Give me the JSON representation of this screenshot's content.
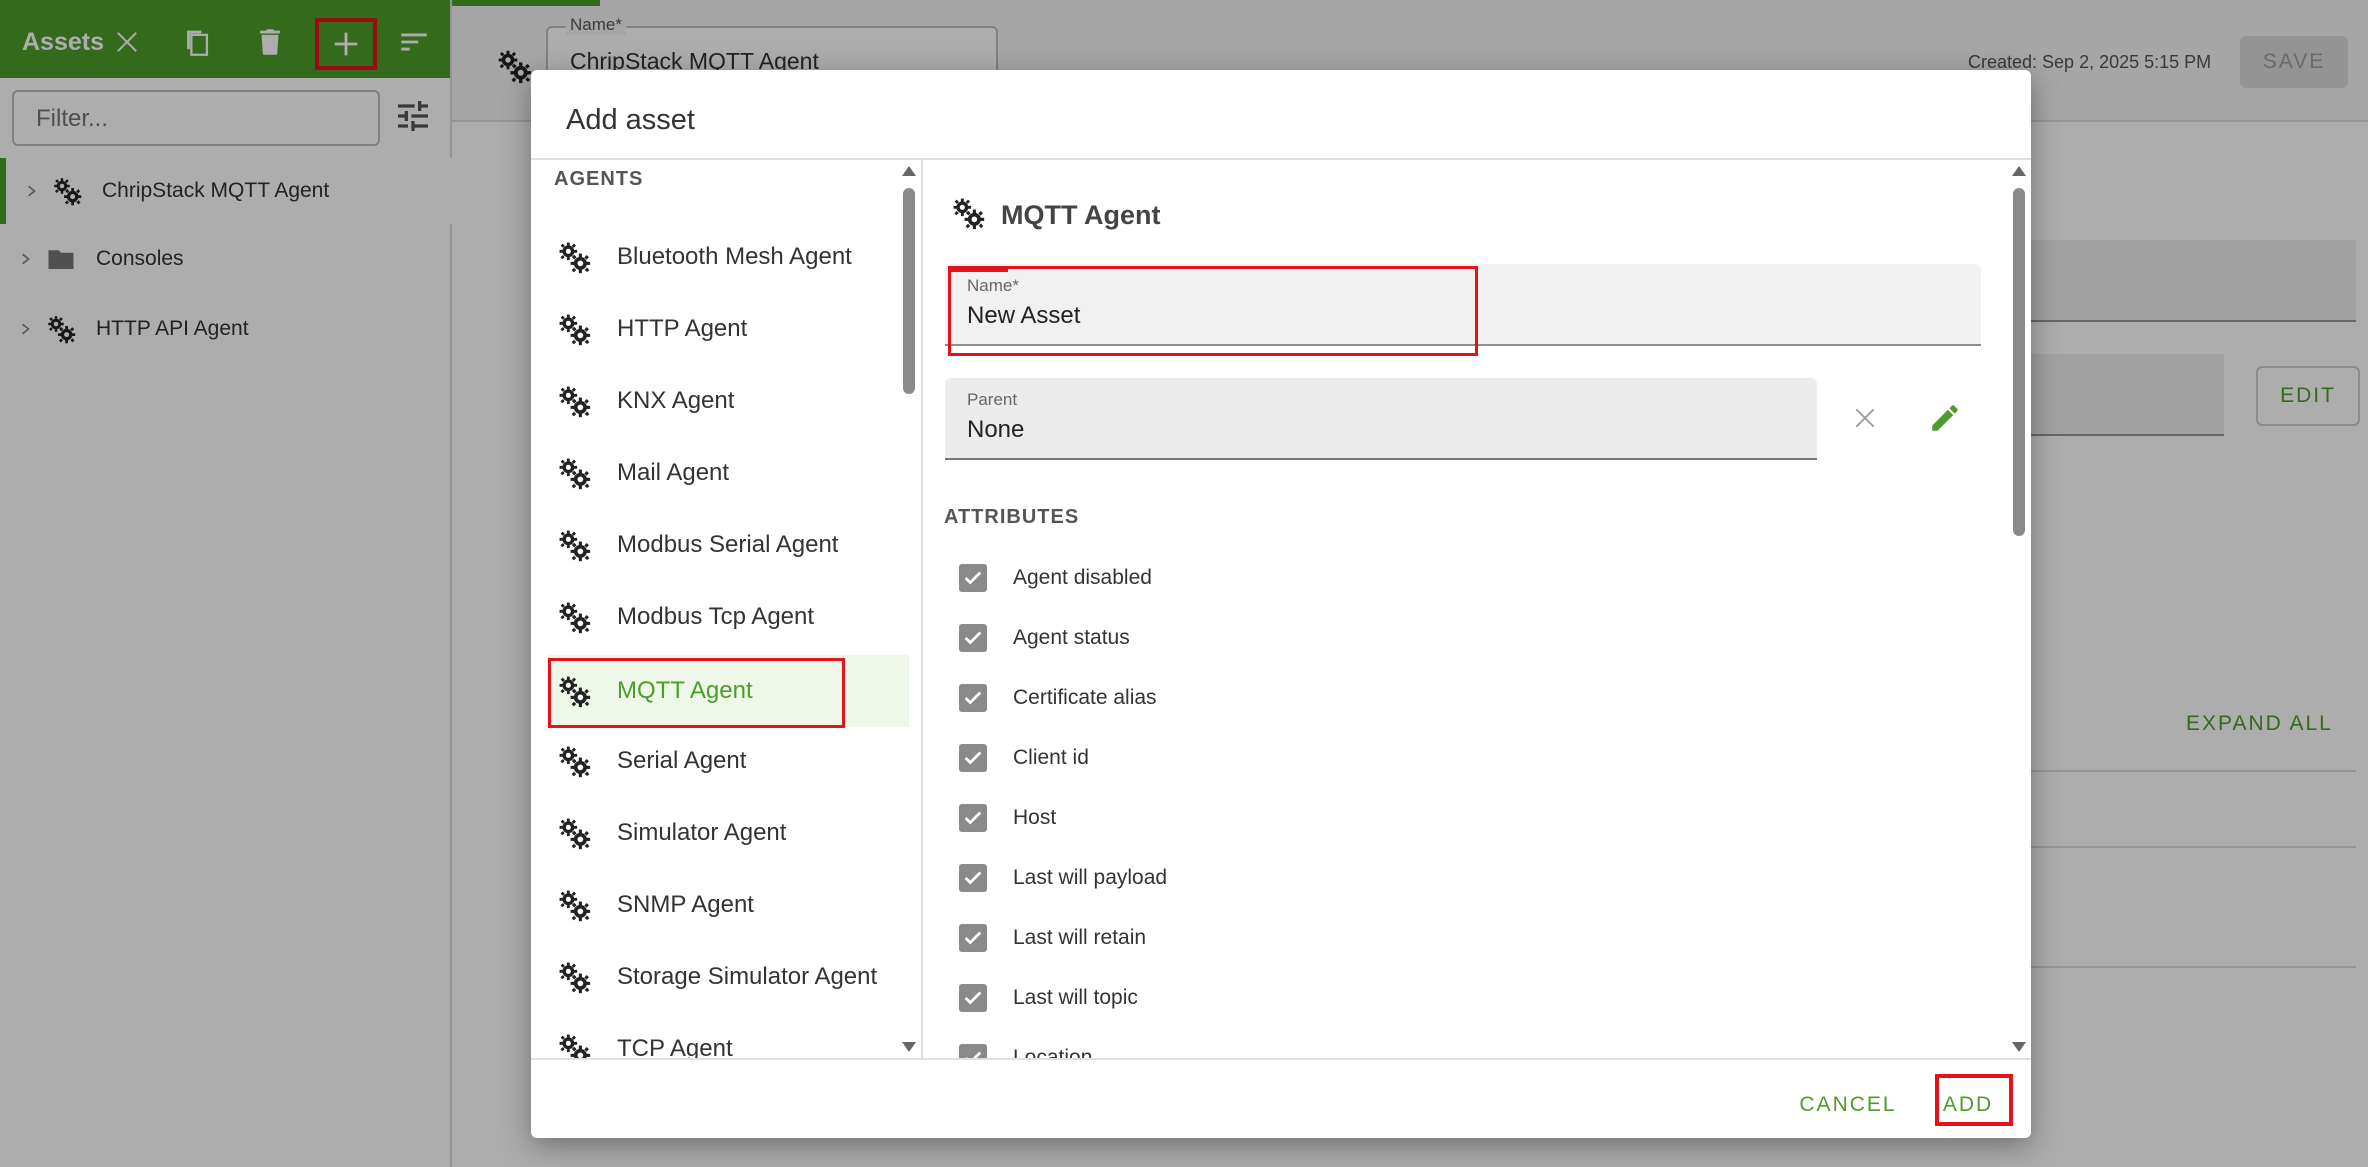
{
  "sidebar": {
    "title": "Assets",
    "filter_placeholder": "Filter...",
    "tree": [
      {
        "label": "ChripStack MQTT Agent",
        "icon": "gears-icon"
      },
      {
        "label": "Consoles",
        "icon": "folder-icon"
      },
      {
        "label": "HTTP API Agent",
        "icon": "gears-icon"
      }
    ]
  },
  "topbar": {
    "name_label": "Name*",
    "name_value": "ChripStack MQTT Agent",
    "created": "Created: Sep 2, 2025 5:15 PM",
    "save_label": "SAVE"
  },
  "background": {
    "edit_label": "EDIT",
    "expand_all_label": "EXPAND ALL"
  },
  "dialog": {
    "title": "Add asset",
    "list_heading": "AGENTS",
    "agents": [
      {
        "label": "Bluetooth Mesh Agent"
      },
      {
        "label": "HTTP Agent"
      },
      {
        "label": "KNX Agent"
      },
      {
        "label": "Mail Agent"
      },
      {
        "label": "Modbus Serial Agent"
      },
      {
        "label": "Modbus Tcp Agent"
      },
      {
        "label": "MQTT Agent",
        "selected": true
      },
      {
        "label": "Serial Agent"
      },
      {
        "label": "Simulator Agent"
      },
      {
        "label": "SNMP Agent"
      },
      {
        "label": "Storage Simulator Agent"
      },
      {
        "label": "TCP Agent"
      }
    ],
    "detail": {
      "title": "MQTT Agent",
      "name_label": "Name*",
      "name_value": "New Asset",
      "parent_label": "Parent",
      "parent_value": "None",
      "attributes_heading": "ATTRIBUTES",
      "attributes": [
        {
          "label": "Agent disabled",
          "checked": true
        },
        {
          "label": "Agent status",
          "checked": true
        },
        {
          "label": "Certificate alias",
          "checked": true
        },
        {
          "label": "Client id",
          "checked": true
        },
        {
          "label": "Host",
          "checked": true
        },
        {
          "label": "Last will payload",
          "checked": true
        },
        {
          "label": "Last will retain",
          "checked": true
        },
        {
          "label": "Last will topic",
          "checked": true
        },
        {
          "label": "Location",
          "checked": true
        }
      ]
    },
    "cancel_label": "CANCEL",
    "add_label": "ADD"
  },
  "colors": {
    "accent": "#4c9d2a",
    "highlight": "#e3121b"
  }
}
